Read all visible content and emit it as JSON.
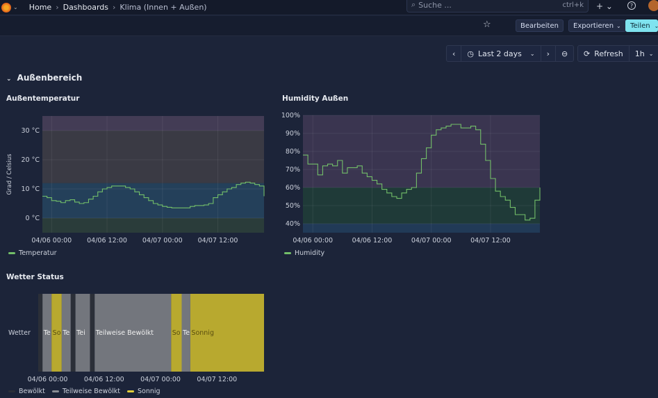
{
  "topbar": {
    "breadcrumb": [
      "Home",
      "Dashboards",
      "Klima (Innen + Außen)"
    ],
    "search_placeholder": "Suche ...",
    "search_shortcut": "ctrl+k",
    "icons": [
      "grafana-logo",
      "plus-icon",
      "help-icon",
      "avatar"
    ]
  },
  "toolbar": {
    "edit_label": "Bearbeiten",
    "export_label": "Exportieren",
    "share_label": "Teilen"
  },
  "time": {
    "range_label": "Last 2 days",
    "refresh_label": "Refresh",
    "refresh_interval": "1h"
  },
  "section": {
    "title": "Außenbereich"
  },
  "panels": {
    "temp_title": "Außentemperatur",
    "hum_title": "Humidity Außen",
    "status_title": "Wetter Status"
  },
  "chart_data": [
    {
      "type": "line",
      "title": "Außentemperatur",
      "ylabel": "Grad / Celsius",
      "ylim": [
        -5,
        35
      ],
      "yticks": [
        "0 °C",
        "10 °C",
        "20 °C",
        "30 °C"
      ],
      "ytick_values": [
        0,
        10,
        20,
        30
      ],
      "xticks": [
        "04/06 00:00",
        "04/06 12:00",
        "04/07 00:00",
        "04/07 12:00"
      ],
      "x_range": [
        "04/05 22:00",
        "04/07 22:00"
      ],
      "x_step": "1h",
      "thresholds": [
        {
          "from": -5,
          "to": 0,
          "color": "#2a3c3a"
        },
        {
          "from": 0,
          "to": 12,
          "color": "#24405a"
        },
        {
          "from": 12,
          "to": 30,
          "color": "#3a3a44"
        },
        {
          "from": 30,
          "to": 35,
          "color": "#433c55"
        }
      ],
      "series": [
        {
          "name": "Temperatur",
          "color": "#73bf69",
          "values": [
            7.5,
            7,
            6,
            5.8,
            5.3,
            6,
            6.3,
            5.5,
            5,
            5.3,
            6.5,
            7.5,
            9,
            10,
            10.5,
            11,
            11,
            11,
            10.5,
            10,
            9,
            8,
            7,
            6,
            5,
            4.5,
            4,
            3.7,
            3.5,
            3.5,
            3.5,
            3.5,
            4,
            4.3,
            4.3,
            4.5,
            5,
            7,
            8,
            9,
            10,
            10.5,
            11.5,
            12,
            12.3,
            12,
            11.5,
            11,
            7.5
          ]
        }
      ]
    },
    {
      "type": "line",
      "title": "Humidity Außen",
      "ylim": [
        35,
        100
      ],
      "yticks": [
        "40%",
        "50%",
        "60%",
        "70%",
        "80%",
        "90%",
        "100%"
      ],
      "ytick_values": [
        40,
        50,
        60,
        70,
        80,
        90,
        100
      ],
      "xticks": [
        "04/06 00:00",
        "04/06 12:00",
        "04/07 00:00",
        "04/07 12:00"
      ],
      "x_range": [
        "04/05 22:00",
        "04/07 22:00"
      ],
      "x_step": "1h",
      "thresholds": [
        {
          "from": 35,
          "to": 40,
          "color": "#213a57"
        },
        {
          "from": 40,
          "to": 60,
          "color": "#1f3a38"
        },
        {
          "from": 60,
          "to": 100,
          "color": "#3a3550"
        }
      ],
      "series": [
        {
          "name": "Humidity",
          "color": "#73bf69",
          "values": [
            78,
            73,
            73,
            67,
            72,
            73,
            72,
            75,
            68,
            71,
            71,
            72,
            68,
            66,
            64,
            62,
            59,
            57,
            55,
            54,
            57,
            59,
            60,
            68,
            76,
            82,
            89,
            92,
            93,
            94,
            95,
            95,
            93,
            93,
            94,
            92,
            84,
            75,
            65,
            58,
            55,
            53,
            49,
            45,
            45,
            42,
            43,
            53,
            60
          ]
        }
      ]
    },
    {
      "type": "state-timeline",
      "title": "Wetter Status",
      "row_label": "Wetter",
      "xticks": [
        "04/06 00:00",
        "04/06 12:00",
        "04/07 00:00",
        "04/07 12:00"
      ],
      "x_range": [
        "04/05 22:00",
        "04/07 22:00"
      ],
      "states": [
        {
          "name": "Bewölkt",
          "color": "#2b2f38"
        },
        {
          "name": "Teilweise Bewölkt",
          "color": "#73767d"
        },
        {
          "name": "Sonnig",
          "color": "#b8a92f"
        }
      ],
      "segments": [
        {
          "start": "04/05 22:00",
          "state": "Bewölkt",
          "label": ""
        },
        {
          "start": "04/05 22:55",
          "state": "Teilweise Bewölkt",
          "label": "Te"
        },
        {
          "start": "04/06 00:50",
          "state": "Sonnig",
          "label": "So"
        },
        {
          "start": "04/06 03:00",
          "state": "Teilweise Bewölkt",
          "label": "Te"
        },
        {
          "start": "04/06 04:55",
          "state": "Bewölkt",
          "label": ""
        },
        {
          "start": "04/06 05:55",
          "state": "Teilweise Bewölkt",
          "label": "Tei"
        },
        {
          "start": "04/06 09:00",
          "state": "Bewölkt",
          "label": ""
        },
        {
          "start": "04/06 10:00",
          "state": "Teilweise Bewölkt",
          "label": "Teilweise Bewölkt"
        },
        {
          "start": "04/07 02:15",
          "state": "Sonnig",
          "label": "So"
        },
        {
          "start": "04/07 04:30",
          "state": "Teilweise Bewölkt",
          "label": "Te"
        },
        {
          "start": "04/07 06:20",
          "state": "Sonnig",
          "label": "Sonnig"
        }
      ]
    }
  ]
}
